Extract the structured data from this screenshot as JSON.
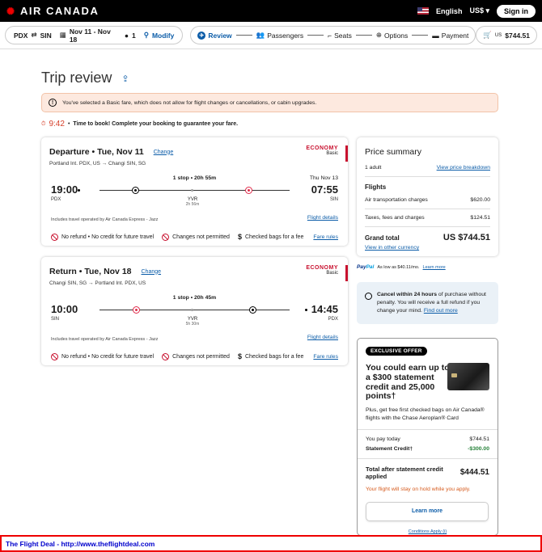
{
  "header": {
    "brand": "AIR CANADA",
    "language": "English",
    "currency": "US$",
    "signin": "Sign in"
  },
  "subbar": {
    "origin": "PDX",
    "destination": "SIN",
    "dates": "Nov 11 - Nov 18",
    "passengers": "1",
    "modify": "Modify",
    "steps": [
      "Review",
      "Passengers",
      "Seats",
      "Options",
      "Payment"
    ],
    "cart_prefix": "US",
    "cart_total": "$744.51"
  },
  "page_title": "Trip review",
  "warning": "You've selected a Basic fare, which does not allow for flight changes or cancellations, or cabin upgrades.",
  "timer": {
    "time": "9:42",
    "message": "Time to book! Complete your booking to guarantee your fare."
  },
  "flights": [
    {
      "heading": "Departure • Tue, Nov 11",
      "change": "Change",
      "route": "Portland Int. PDX, US → Changi SIN, SG",
      "cabin": "ECONOMY",
      "fare": "Basic",
      "stops": "1 stop • 20h 55m",
      "arrival_date": "Thu Nov 13",
      "dep_time": "19:00",
      "dep_code": "PDX",
      "arr_time": "07:55",
      "arr_code": "SIN",
      "stop_code": "YVR",
      "stop_duration": "2h 56m",
      "operated": "Includes travel operated by Air Canada Express - Jazz",
      "details": "Flight details"
    },
    {
      "heading": "Return • Tue, Nov 18",
      "change": "Change",
      "route": "Changi SIN, SG → Portland Int. PDX, US",
      "cabin": "ECONOMY",
      "fare": "Basic",
      "stops": "1 stop • 20h 45m",
      "arrival_date": "",
      "dep_time": "10:00",
      "dep_code": "SIN",
      "arr_time": "14:45",
      "arr_code": "PDX",
      "stop_code": "YVR",
      "stop_duration": "5h 30m",
      "operated": "Includes travel operated by Air Canada Express - Jazz",
      "details": "Flight details"
    }
  ],
  "conditions": {
    "refund": "No refund • No credit for future travel",
    "changes": "Changes not permitted",
    "bags": "Checked bags for a fee",
    "fare_rules": "Fare rules"
  },
  "price_summary": {
    "title": "Price summary",
    "adults": "1 adult",
    "breakdown_link": "View price breakdown",
    "flights_heading": "Flights",
    "air_label": "Air transportation charges",
    "air_value": "$620.00",
    "tax_label": "Taxes, fees and charges",
    "tax_value": "$124.51",
    "total_label": "Grand total",
    "total_value": "US $744.51",
    "currency_link": "View in other currency"
  },
  "paypal": {
    "brand_pay": "Pay",
    "brand_pal": "Pal",
    "text": "As low as $40.11/mo.",
    "link": "Learn more"
  },
  "cancel_info": {
    "bold": "Cancel within 24 hours",
    "text": "of purchase without penalty. You will receive a full refund if you change your mind.",
    "link": "Find out more"
  },
  "offer": {
    "badge": "EXCLUSIVE OFFER",
    "headline": "You could earn up to a $300 statement credit and 25,000 points†",
    "body": "Plus, get free first checked bags on Air Canada® flights with the Chase Aeroplan® Card",
    "pay_label": "You pay today",
    "pay_value": "$744.51",
    "credit_label": "Statement Credit†",
    "credit_value": "-$300.00",
    "total_label": "Total after statement credit applied",
    "total_value": "$444.51",
    "hold": "Your flight will stay on hold while you apply.",
    "learn_more": "Learn more",
    "conditions": "Conditions Apply (i)"
  },
  "footer": "The Flight Deal - http://www.theflightdeal.com"
}
